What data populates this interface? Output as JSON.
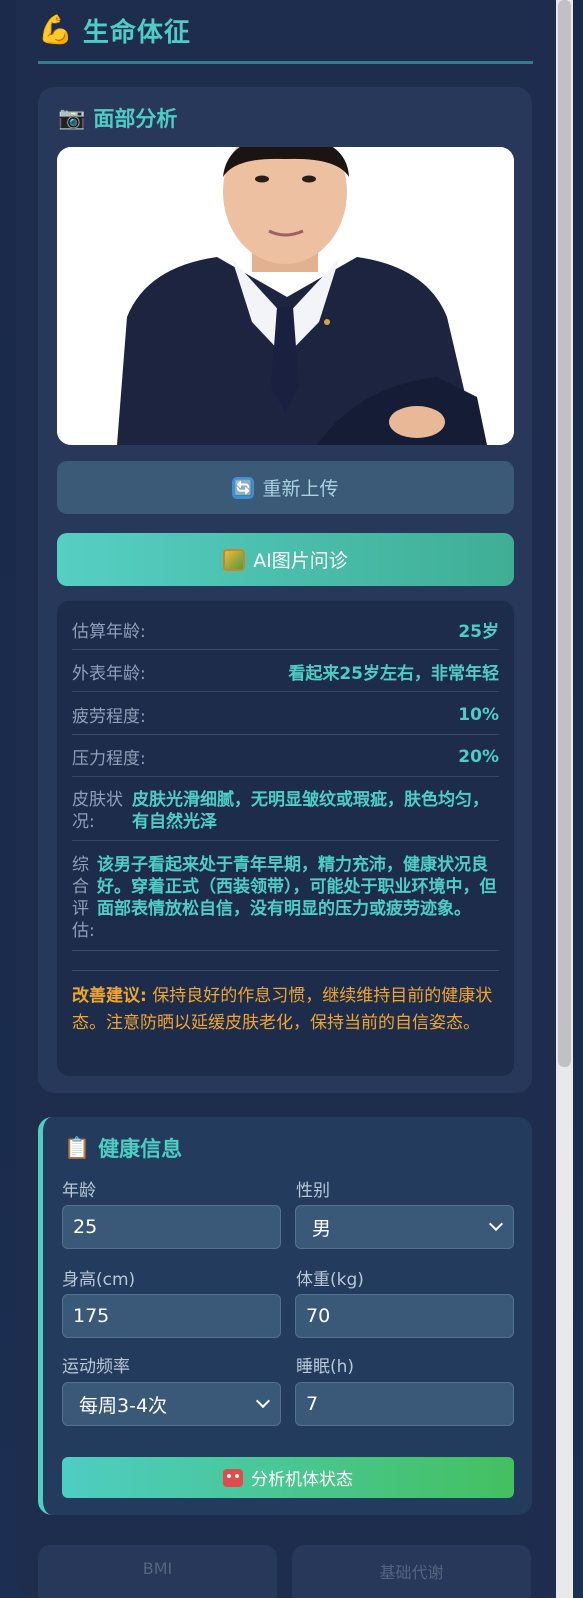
{
  "header": {
    "icon": "flexed-biceps-icon",
    "title": "生命体征"
  },
  "face_analysis": {
    "icon": "camera-icon",
    "title": "面部分析",
    "reupload_label": "重新上传",
    "ai_button_label": "AI图片问诊",
    "results": [
      {
        "label": "估算年龄:",
        "value": "25岁"
      },
      {
        "label": "外表年龄:",
        "value": "看起来25岁左右，非常年轻"
      },
      {
        "label": "疲劳程度:",
        "value": "10%"
      },
      {
        "label": "压力程度:",
        "value": "20%"
      }
    ],
    "skin": {
      "label": "皮肤状况:",
      "value": "皮肤光滑细腻，无明显皱纹或瑕疵，肤色均匀，有自然光泽"
    },
    "overall": {
      "label": "综合评估:",
      "value": "该男子看起来处于青年早期，精力充沛，健康状况良好。穿着正式（西装领带），可能处于职业环境中，但面部表情放松自信，没有明显的压力或疲劳迹象。"
    },
    "advice_label": "改善建议:",
    "advice_text": "保持良好的作息习惯，继续维持目前的健康状态。注意防晒以延缓皮肤老化，保持当前的自信姿态。"
  },
  "health_info": {
    "icon": "clipboard-icon",
    "title": "健康信息",
    "age_label": "年龄",
    "age_value": "25",
    "gender_label": "性别",
    "gender_value": "男",
    "height_label": "身高(cm)",
    "height_value": "175",
    "weight_label": "体重(kg)",
    "weight_value": "70",
    "exercise_label": "运动频率",
    "exercise_value": "每周3-4次",
    "sleep_label": "睡眠(h)",
    "sleep_value": "7",
    "analyze_button_label": "分析机体状态"
  },
  "bottom_cards": [
    "BMI",
    "基础代谢"
  ],
  "colors": {
    "accent": "#4ecdc4",
    "advice": "#f0a531",
    "panel": "#1e2d4e"
  }
}
